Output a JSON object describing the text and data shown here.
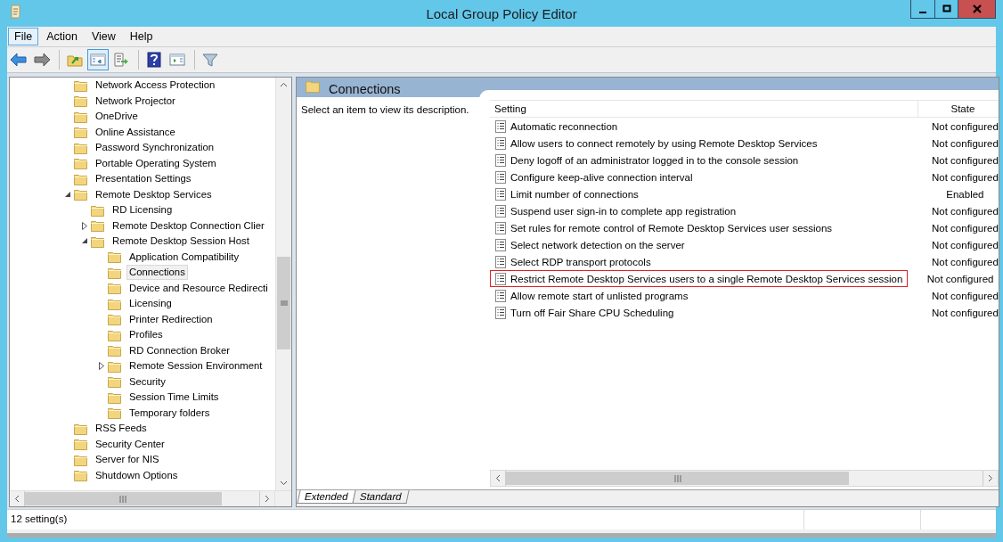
{
  "window": {
    "title": "Local Group Policy Editor"
  },
  "menu": [
    {
      "label": "File",
      "selected": true
    },
    {
      "label": "Action",
      "selected": false
    },
    {
      "label": "View",
      "selected": false
    },
    {
      "label": "Help",
      "selected": false
    }
  ],
  "toolbar": [
    {
      "kind": "back",
      "pressed": false
    },
    {
      "kind": "forward",
      "pressed": false
    },
    {
      "kind": "sep"
    },
    {
      "kind": "up",
      "pressed": false
    },
    {
      "kind": "tree",
      "pressed": true
    },
    {
      "kind": "export",
      "pressed": false
    },
    {
      "kind": "sep"
    },
    {
      "kind": "help",
      "pressed": false
    },
    {
      "kind": "pane",
      "pressed": false
    },
    {
      "kind": "sep"
    },
    {
      "kind": "filter",
      "pressed": false
    }
  ],
  "tree": [
    {
      "label": "Network Access Protection",
      "selected": false
    },
    {
      "label": "Network Projector",
      "selected": false
    },
    {
      "label": "OneDrive",
      "selected": false
    },
    {
      "label": "Online Assistance",
      "selected": false
    },
    {
      "label": "Password Synchronization",
      "selected": false
    },
    {
      "label": "Portable Operating System",
      "selected": false
    },
    {
      "label": "Presentation Settings",
      "selected": false
    },
    {
      "label": "Remote Desktop Services",
      "selected": false,
      "expanded": true,
      "children": [
        {
          "label": "RD Licensing",
          "selected": false
        },
        {
          "label": "Remote Desktop Connection Clier",
          "selected": false,
          "expanded": false
        },
        {
          "label": "Remote Desktop Session Host",
          "selected": false,
          "expanded": true,
          "children": [
            {
              "label": "Application Compatibility",
              "selected": false
            },
            {
              "label": "Connections",
              "selected": true
            },
            {
              "label": "Device and Resource Redirecti",
              "selected": false
            },
            {
              "label": "Licensing",
              "selected": false
            },
            {
              "label": "Printer Redirection",
              "selected": false
            },
            {
              "label": "Profiles",
              "selected": false
            },
            {
              "label": "RD Connection Broker",
              "selected": false
            },
            {
              "label": "Remote Session Environment",
              "selected": false,
              "expanded": false
            },
            {
              "label": "Security",
              "selected": false
            },
            {
              "label": "Session Time Limits",
              "selected": false
            },
            {
              "label": "Temporary folders",
              "selected": false
            }
          ]
        }
      ]
    },
    {
      "label": "RSS Feeds",
      "selected": false
    },
    {
      "label": "Security Center",
      "selected": false
    },
    {
      "label": "Server for NIS",
      "selected": false
    },
    {
      "label": "Shutdown Options",
      "selected": false
    }
  ],
  "details": {
    "title": "Connections",
    "description": "Select an item to view its description.",
    "columns": [
      "Setting",
      "State"
    ],
    "rows": [
      {
        "setting": "Automatic reconnection",
        "state": "Not configured",
        "outlined": false
      },
      {
        "setting": "Allow users to connect remotely by using Remote Desktop Services",
        "state": "Not configured",
        "outlined": false
      },
      {
        "setting": "Deny logoff of an administrator logged in to the console session",
        "state": "Not configured",
        "outlined": false
      },
      {
        "setting": "Configure keep-alive connection interval",
        "state": "Not configured",
        "outlined": false
      },
      {
        "setting": "Limit number of connections",
        "state": "Enabled",
        "outlined": false
      },
      {
        "setting": "Suspend user sign-in to complete app registration",
        "state": "Not configured",
        "outlined": false
      },
      {
        "setting": "Set rules for remote control of Remote Desktop Services user sessions",
        "state": "Not configured",
        "outlined": false
      },
      {
        "setting": "Select network detection on the server",
        "state": "Not configured",
        "outlined": false
      },
      {
        "setting": "Select RDP transport protocols",
        "state": "Not configured",
        "outlined": false
      },
      {
        "setting": "Restrict Remote Desktop Services users to a single Remote Desktop Services session",
        "state": "Not configured",
        "outlined": true
      },
      {
        "setting": "Allow remote start of unlisted programs",
        "state": "Not configured",
        "outlined": false
      },
      {
        "setting": "Turn off Fair Share CPU Scheduling",
        "state": "Not configured",
        "outlined": false
      }
    ],
    "tabs": [
      {
        "label": "Extended",
        "selected": true
      },
      {
        "label": "Standard",
        "selected": false
      }
    ]
  },
  "status_bar": {
    "text": "12 setting(s)"
  }
}
